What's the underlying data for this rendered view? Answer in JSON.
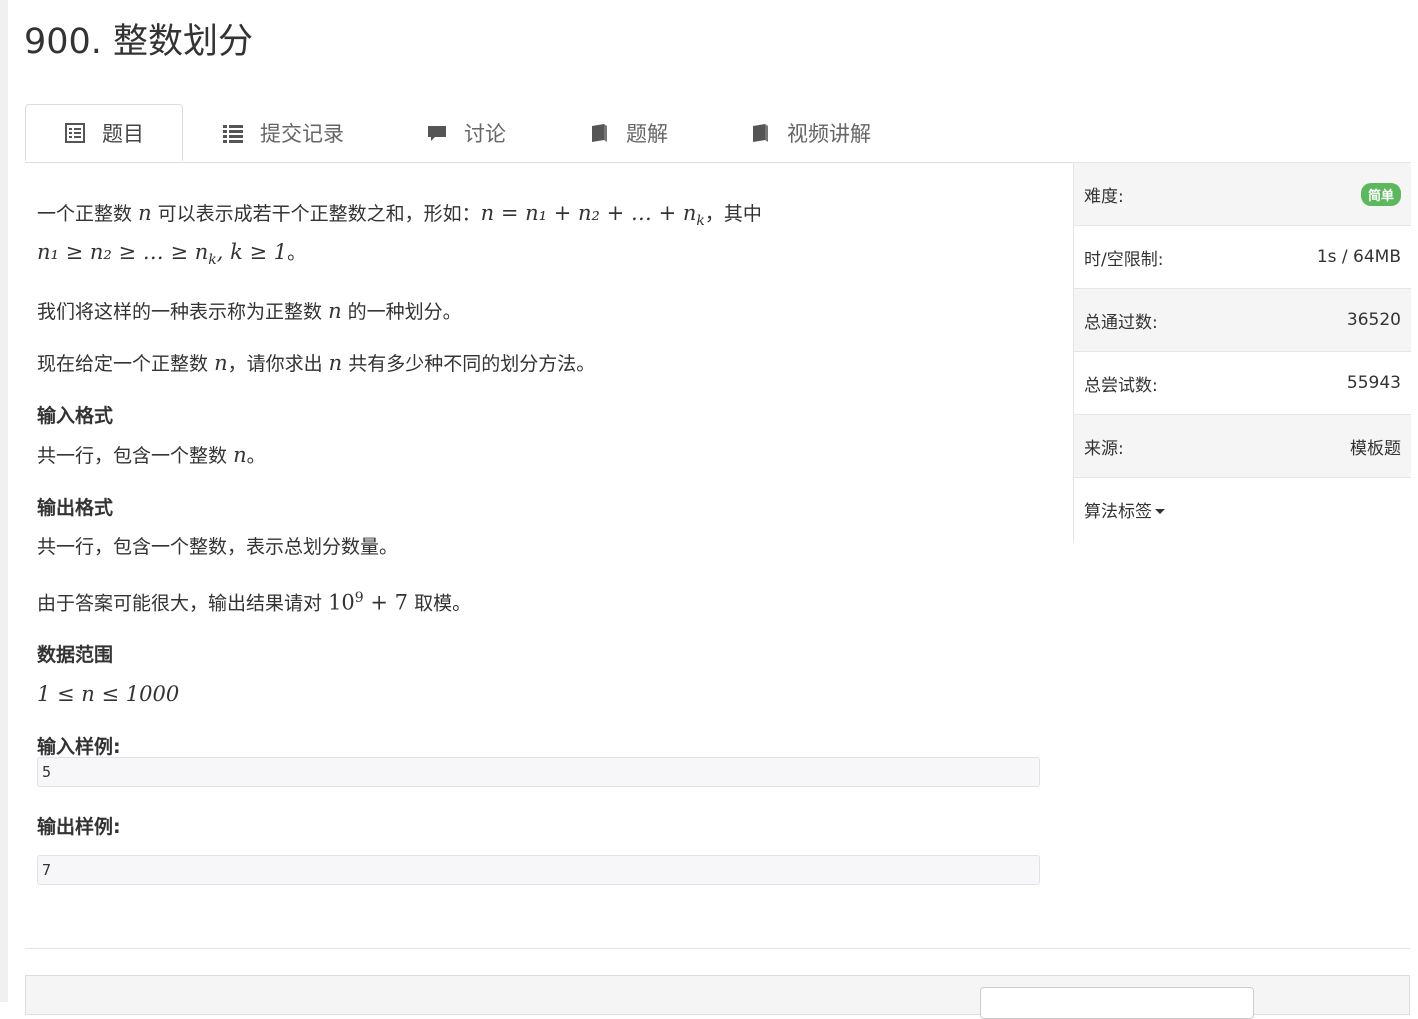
{
  "problem": {
    "title": "900. 整数划分"
  },
  "tabs": [
    {
      "label": "题目",
      "icon": "list-alt-icon",
      "active": true
    },
    {
      "label": "提交记录",
      "icon": "list-icon",
      "active": false
    },
    {
      "label": "讨论",
      "icon": "comment-icon",
      "active": false
    },
    {
      "label": "题解",
      "icon": "book-icon",
      "active": false
    },
    {
      "label": "视频讲解",
      "icon": "book-icon",
      "active": false
    }
  ],
  "statement": {
    "p1_a": "一个正整数",
    "p1_n": "n",
    "p1_b": "可以表示成若干个正整数之和，形如：",
    "p1_formula_a": "n = n₁ + n₂ + … + n",
    "p1_formula_k": "k",
    "p1_c": "，其中",
    "p1_formula2_a": "n₁ ≥ n₂ ≥ … ≥ n",
    "p1_formula2_k": "k",
    "p1_formula2_b": ", k ≥ 1",
    "p1_end": "。",
    "p2_a": "我们将这样的一种表示称为正整数",
    "p2_n": "n",
    "p2_b": "的一种划分。",
    "p3_a": "现在给定一个正整数",
    "p3_n": "n",
    "p3_b": "，请你求出",
    "p3_n2": "n",
    "p3_c": "共有多少种不同的划分方法。",
    "input_format_title": "输入格式",
    "input_format_a": "共一行，包含一个整数",
    "input_format_n": "n",
    "input_format_b": "。",
    "output_format_title": "输出格式",
    "output_format": "共一行，包含一个整数，表示总划分数量。",
    "mod_a": "由于答案可能很大，输出结果请对",
    "mod_base": "10",
    "mod_exp": "9",
    "mod_plus": " + 7",
    "mod_b": "取模。",
    "range_title": "数据范围",
    "range_formula": "1 ≤ n ≤ 1000",
    "sample_input_title": "输入样例:",
    "sample_input": "5",
    "sample_output_title": "输出样例:",
    "sample_output": "7"
  },
  "sidebar": {
    "difficulty_label": "难度:",
    "difficulty_value": "简单",
    "difficulty_color": "#5cb85c",
    "limit_label": "时/空限制:",
    "limit_value": "1s / 64MB",
    "passed_label": "总通过数:",
    "passed_value": "36520",
    "tried_label": "总尝试数:",
    "tried_value": "55943",
    "source_label": "来源:",
    "source_value": "模板题",
    "tags_label": "算法标签"
  }
}
